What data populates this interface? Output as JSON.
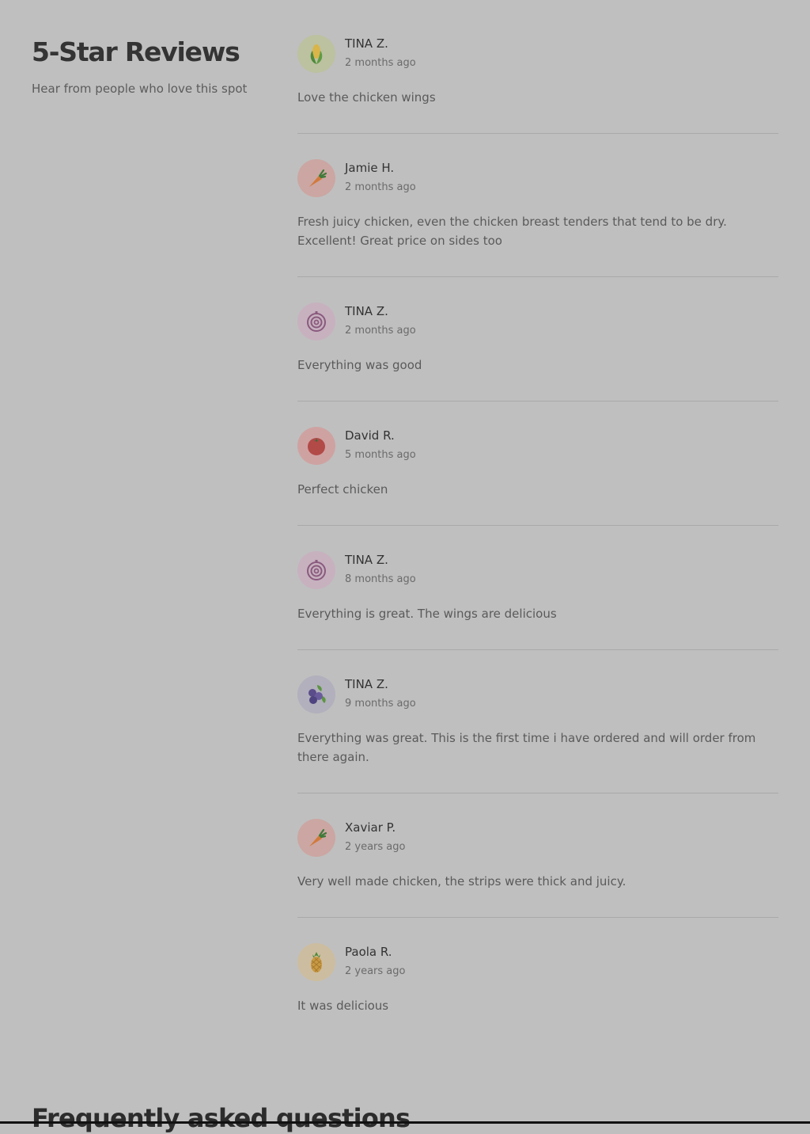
{
  "reviews_section": {
    "title": "5-Star Reviews",
    "subtitle": "Hear from people who love this spot"
  },
  "reviews": [
    {
      "name": "TINA Z.",
      "date": "2 months ago",
      "text": "Love the chicken wings",
      "avatar_icon": "corn-icon",
      "avatar_bg": "#bcc1a0"
    },
    {
      "name": "Jamie H.",
      "date": "2 months ago",
      "text": "Fresh juicy chicken, even the chicken breast tenders that tend to be dry. Excellent! Great price on sides too",
      "avatar_icon": "carrot-icon",
      "avatar_bg": "#cba6a2"
    },
    {
      "name": "TINA Z.",
      "date": "2 months ago",
      "text": "Everything was good",
      "avatar_icon": "onion-icon",
      "avatar_bg": "#c7b1bf"
    },
    {
      "name": "David R.",
      "date": "5 months ago",
      "text": "Perfect chicken",
      "avatar_icon": "tomato-icon",
      "avatar_bg": "#cfa2a2"
    },
    {
      "name": "TINA Z.",
      "date": "8 months ago",
      "text": "Everything is great. The wings are delicious",
      "avatar_icon": "onion-icon",
      "avatar_bg": "#c7b1bf"
    },
    {
      "name": "TINA Z.",
      "date": "9 months ago",
      "text": "Everything was great. This is the first time i have ordered and will order from there again.",
      "avatar_icon": "blueberry-icon",
      "avatar_bg": "#b2b0bc"
    },
    {
      "name": "Xaviar P.",
      "date": "2 years ago",
      "text": "Very well made chicken, the strips were thick and juicy.",
      "avatar_icon": "carrot-icon",
      "avatar_bg": "#cba6a2"
    },
    {
      "name": "Paola R.",
      "date": "2 years ago",
      "text": "It was delicious",
      "avatar_icon": "pineapple-icon",
      "avatar_bg": "#cdbda0"
    }
  ],
  "faq": {
    "title": "Frequently asked questions"
  }
}
